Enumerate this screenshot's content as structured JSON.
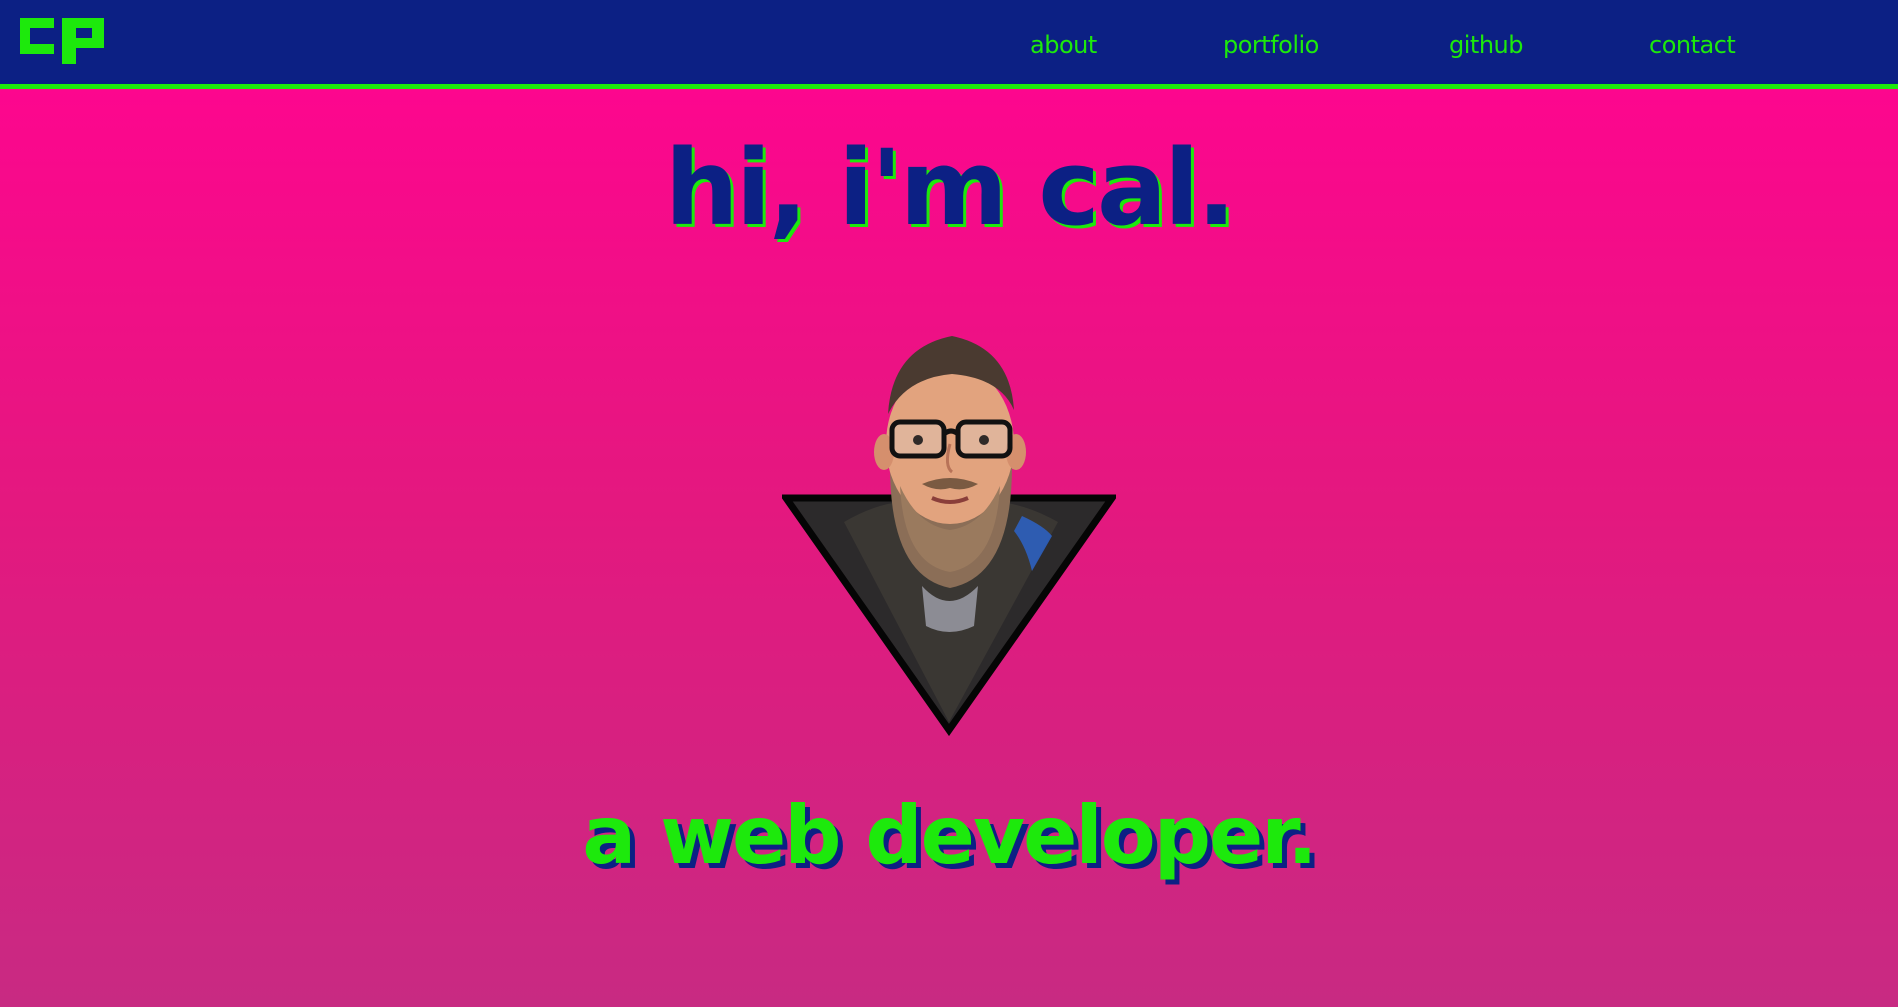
{
  "nav": {
    "logo_text": "cp",
    "items": [
      {
        "label": "about"
      },
      {
        "label": "portfolio"
      },
      {
        "label": "github"
      },
      {
        "label": "contact"
      }
    ]
  },
  "hero": {
    "headline": "hi, i'm cal.",
    "subheadline": "a web developer."
  },
  "colors": {
    "nav_background": "#0c2084",
    "accent_green": "#1de90c",
    "hero_top": "#fd068e",
    "hero_bottom": "#c82a82"
  }
}
